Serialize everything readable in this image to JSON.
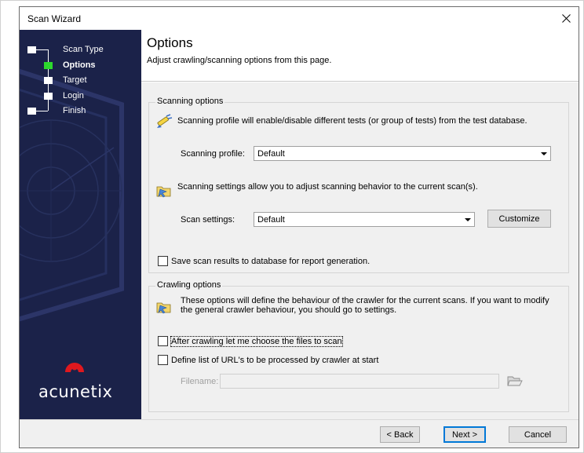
{
  "window": {
    "title": "Scan Wizard",
    "close_glyph": "×"
  },
  "steps": [
    {
      "label": "Scan Type",
      "active": false
    },
    {
      "label": "Options",
      "active": true
    },
    {
      "label": "Target",
      "active": false
    },
    {
      "label": "Login",
      "active": false
    },
    {
      "label": "Finish",
      "active": false
    }
  ],
  "brand": {
    "name": "acunetix",
    "logo_color": "#e0181e",
    "sidebar_color": "#1b2249"
  },
  "header": {
    "title": "Options",
    "subtitle": "Adjust crawling/scanning options from this page."
  },
  "scanning": {
    "group_title": "Scanning options",
    "profile_desc": "Scanning profile will enable/disable different tests (or group of tests) from the test database.",
    "profile_label": "Scanning profile:",
    "profile_value": "Default",
    "settings_desc": "Scanning settings allow you to adjust scanning behavior to the current scan(s).",
    "settings_label": "Scan settings:",
    "settings_value": "Default",
    "customize_label": "Customize",
    "save_results_label": "Save scan results to database for report generation."
  },
  "crawling": {
    "group_title": "Crawling options",
    "desc_line1": "These options will define the behaviour of the crawler for the current scans. If you want to modify",
    "desc_line2": "the general crawler behaviour, you should go to settings.",
    "choose_files_label": "After crawling let me choose the files to scan",
    "define_list_label": "Define list of URL's to be processed by crawler at start",
    "filename_label": "Filename:",
    "filename_value": ""
  },
  "footer": {
    "back_label": "< Back",
    "next_label": "Next >",
    "cancel_label": "Cancel"
  },
  "icons": {
    "active_step_color": "#2dd82d",
    "accent_focus": "#0078d7"
  }
}
